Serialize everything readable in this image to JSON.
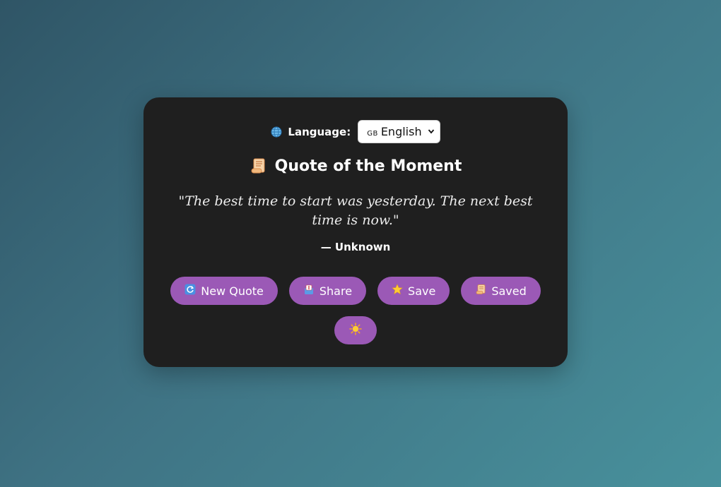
{
  "language": {
    "label": "Language:",
    "selected_flag_code": "GB",
    "selected": "English",
    "icon": "globe-icon"
  },
  "title": {
    "text": "Quote of the Moment",
    "icon": "scroll-icon"
  },
  "quote": {
    "text": "\"The best time to start was yesterday. The next best time is now.\"",
    "author": "— Unknown"
  },
  "buttons": [
    {
      "label": "New Quote",
      "icon": "refresh-icon"
    },
    {
      "label": "Share",
      "icon": "share-icon"
    },
    {
      "label": "Save",
      "icon": "star-icon"
    },
    {
      "label": "Saved",
      "icon": "scroll-icon"
    }
  ],
  "theme_toggle": {
    "icon": "sun-icon"
  },
  "colors": {
    "background_start": "#2f5566",
    "background_end": "#48919c",
    "card": "#1f1f1f",
    "button": "#9b59b6",
    "text": "#ffffff"
  }
}
